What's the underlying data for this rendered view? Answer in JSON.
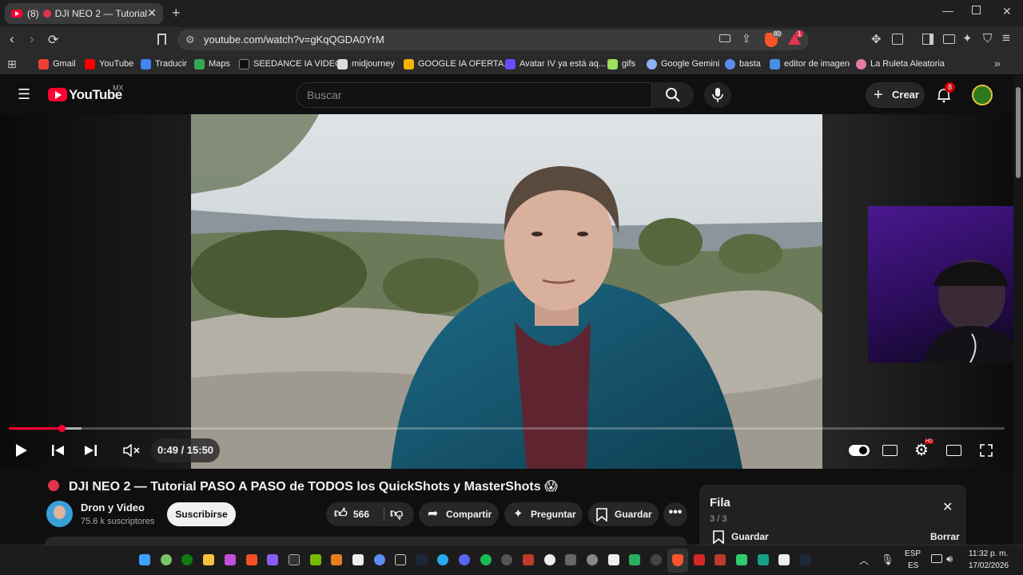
{
  "browser": {
    "tab_count": "(8)",
    "tab_title": "DJI NEO 2 — Tutorial PAS",
    "url": "youtube.com/watch?v=gKqQGDA0YrM",
    "shield_badge": "80",
    "alert_badge": "1"
  },
  "bookmarks": [
    {
      "label": "Gmail",
      "color": "#ea4335"
    },
    {
      "label": "YouTube",
      "color": "#ff0000"
    },
    {
      "label": "Traducir",
      "color": "#4285f4"
    },
    {
      "label": "Maps",
      "color": "#34a853"
    },
    {
      "label": "SEEDANCE IA VIDEO",
      "color": "#111111"
    },
    {
      "label": "midjourney",
      "color": "#dddddd"
    },
    {
      "label": "GOOGLE IA OFERTA...",
      "color": "#f4b400"
    },
    {
      "label": "Avatar IV ya está aq...",
      "color": "#6a4cff"
    },
    {
      "label": "gifs",
      "color": "#9be15d"
    },
    {
      "label": "Google Gemini",
      "color": "#8ab4f8"
    },
    {
      "label": "basta",
      "color": "#5b8def"
    },
    {
      "label": "editor de imagen",
      "color": "#4a90e2"
    },
    {
      "label": "La Ruleta Aleatoria",
      "color": "#e57aa8"
    }
  ],
  "youtube": {
    "logo": "YouTube",
    "region": "MX",
    "search_placeholder": "Buscar",
    "create_label": "Crear",
    "notif_count": "8"
  },
  "player": {
    "time": "0:49 / 15:50",
    "progress": 0.053,
    "progress_color": "#ff0033"
  },
  "video": {
    "title": "DJI NEO 2 — Tutorial PASO A PASO de TODOS los QuickShots y MasterShots 😱",
    "channel": "Dron y Video",
    "subscribers": "75.6 k suscriptores",
    "subscribe_label": "Suscribirse",
    "likes": "566",
    "share_label": "Compartir",
    "ask_label": "Preguntar",
    "save_label": "Guardar"
  },
  "queue": {
    "title": "Fila",
    "position": "3 / 3",
    "save_label": "Guardar",
    "clear_label": "Borrar"
  },
  "taskbar": {
    "lang_top": "ESP",
    "lang_bottom": "ES",
    "clock_time": "11:32 p. m.",
    "clock_date": "17/02/2026"
  }
}
